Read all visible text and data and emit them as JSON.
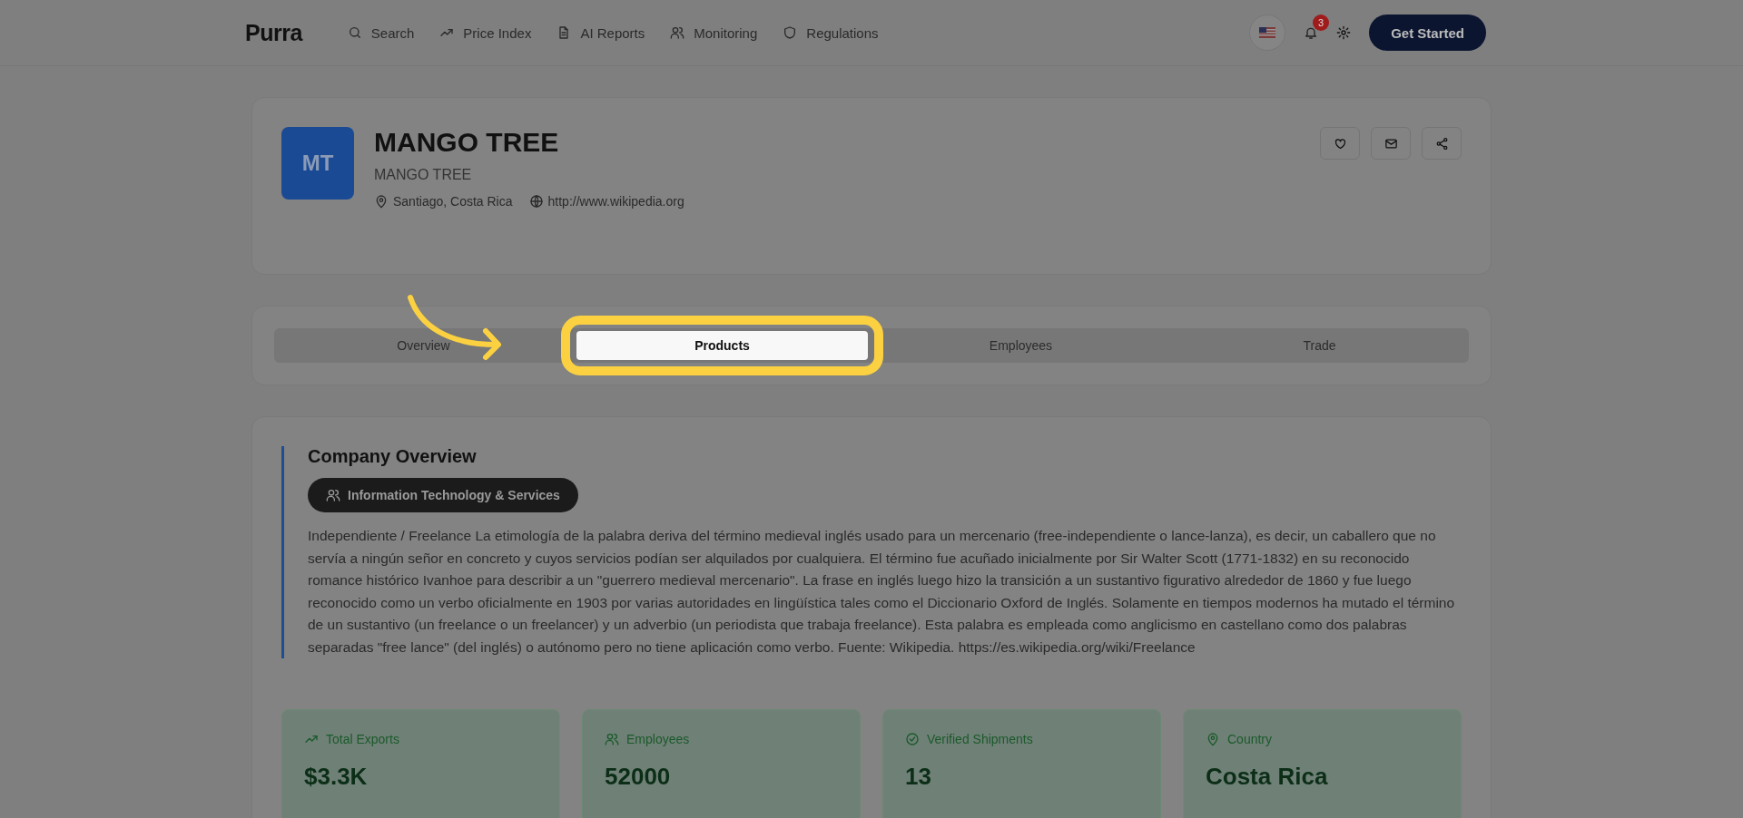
{
  "header": {
    "logo": "Purra",
    "nav": [
      {
        "kind": "search",
        "label": "Search"
      },
      {
        "kind": "trend",
        "label": "Price Index"
      },
      {
        "kind": "doc",
        "label": "AI Reports"
      },
      {
        "kind": "users",
        "label": "Monitoring"
      },
      {
        "kind": "shield",
        "label": "Regulations"
      }
    ],
    "notifications": "3",
    "cta": "Get Started"
  },
  "company": {
    "initials": "MT",
    "name": "MANGO TREE",
    "subtitle": "MANGO TREE",
    "location": "Santiago, Costa Rica",
    "website": "http://www.wikipedia.org"
  },
  "tabs": [
    {
      "label": "Overview",
      "selected": false,
      "spotlight": false
    },
    {
      "label": "Products",
      "selected": true,
      "spotlight": true
    },
    {
      "label": "Employees",
      "selected": false,
      "spotlight": false
    },
    {
      "label": "Trade",
      "selected": false,
      "spotlight": false
    }
  ],
  "overview": {
    "title": "Company Overview",
    "industry": "Information Technology & Services",
    "description": "Independiente / Freelance La etimología de la palabra deriva del término medieval inglés usado para un mercenario (free-independiente o lance-lanza), es decir, un caballero que no servía a ningún señor en concreto y cuyos servicios podían ser alquilados por cualquiera. El término fue acuñado inicialmente por Sir Walter Scott (1771-1832) en su reconocido romance histórico Ivanhoe para describir a un \"guerrero medieval mercenario\". La frase en inglés luego hizo la transición a un sustantivo figurativo alrededor de 1860 y fue luego reconocido como un verbo oficialmente en 1903 por varias autoridades en lingüística tales como el Diccionario Oxford de Inglés. Solamente en tiempos modernos ha mutado el término de un sustantivo (un freelance o un freelancer) y un adverbio (un periodista que trabaja freelance). Esta palabra es empleada como anglicismo en castellano como dos palabras separadas \"free lance\" (del inglés) o autónomo pero no tiene aplicación como verbo. Fuente: Wikipedia. https://es.wikipedia.org/wiki/Freelance"
  },
  "stats": [
    {
      "kind": "trend",
      "label": "Total Exports",
      "value": "$3.3K"
    },
    {
      "kind": "users",
      "label": "Employees",
      "value": "52000"
    },
    {
      "kind": "check",
      "label": "Verified Shipments",
      "value": "13"
    },
    {
      "kind": "pin",
      "label": "Country",
      "value": "Costa Rica"
    }
  ]
}
